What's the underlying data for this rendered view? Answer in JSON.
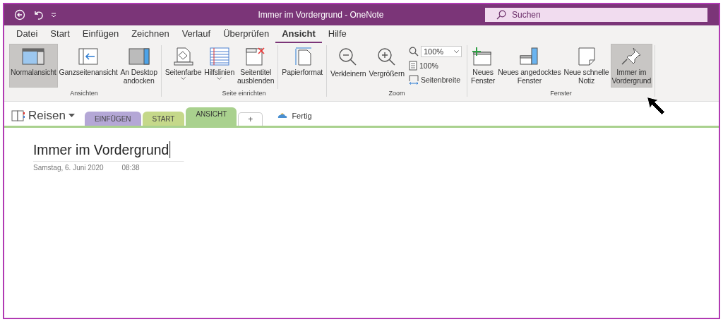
{
  "window": {
    "title": "Immer im Vordergrund  -  OneNote"
  },
  "search": {
    "placeholder": "Suchen"
  },
  "menu_tabs": [
    {
      "label": "Datei",
      "selected": false
    },
    {
      "label": "Start",
      "selected": false
    },
    {
      "label": "Einfügen",
      "selected": false
    },
    {
      "label": "Zeichnen",
      "selected": false
    },
    {
      "label": "Verlauf",
      "selected": false
    },
    {
      "label": "Überprüfen",
      "selected": false
    },
    {
      "label": "Ansicht",
      "selected": true
    },
    {
      "label": "Hilfe",
      "selected": false
    }
  ],
  "ribbon_groups": [
    {
      "label": "Ansichten",
      "items": [
        {
          "kind": "button",
          "label": "Normalansicht",
          "selected": true
        },
        {
          "kind": "button",
          "label": "Ganzseitenansicht",
          "selected": false
        },
        {
          "kind": "button",
          "label": "An Desktop\nandocken",
          "selected": false
        }
      ]
    },
    {
      "label": "Seite einrichten",
      "items": [
        {
          "kind": "dropdown",
          "label": "Seitenfarbe",
          "selected": false
        },
        {
          "kind": "dropdown",
          "label": "Hilfslinien",
          "selected": false
        },
        {
          "kind": "button",
          "label": "Seitentitel\nausblenden",
          "selected": false
        },
        {
          "kind": "divider"
        },
        {
          "kind": "button",
          "label": "Papierformat",
          "selected": false
        }
      ]
    },
    {
      "label": "Zoom",
      "items": [
        {
          "kind": "button",
          "label": "Verkleinern",
          "selected": false
        },
        {
          "kind": "button",
          "label": "Vergrößern",
          "selected": false
        },
        {
          "kind": "stack",
          "zoom_value": "100%",
          "page_zoom": "100%",
          "page_width": "Seitenbreite"
        }
      ]
    },
    {
      "label": "Fenster",
      "items": [
        {
          "kind": "button",
          "label": "Neues\nFenster",
          "selected": false
        },
        {
          "kind": "button",
          "label": "Neues angedocktes\nFenster",
          "selected": false
        },
        {
          "kind": "button",
          "label": "Neue schnelle\nNotiz",
          "selected": false
        },
        {
          "kind": "button",
          "label": "Immer im\nVordergrund",
          "selected": true
        }
      ]
    }
  ],
  "notebook": {
    "name": "Reisen"
  },
  "section_tabs": [
    {
      "label": "EINFÜGEN",
      "color": "#b4a7d6",
      "selected": false
    },
    {
      "label": "START",
      "color": "#c5d88a",
      "selected": false
    },
    {
      "label": "ANSICHT",
      "color": "#a9d18e",
      "selected": true
    }
  ],
  "add_section": {
    "label": "+"
  },
  "done": {
    "label": "Fertig"
  },
  "page": {
    "title": "Immer im Vordergrund",
    "date": "Samstag, 6. Juni 2020",
    "time": "08:38"
  }
}
